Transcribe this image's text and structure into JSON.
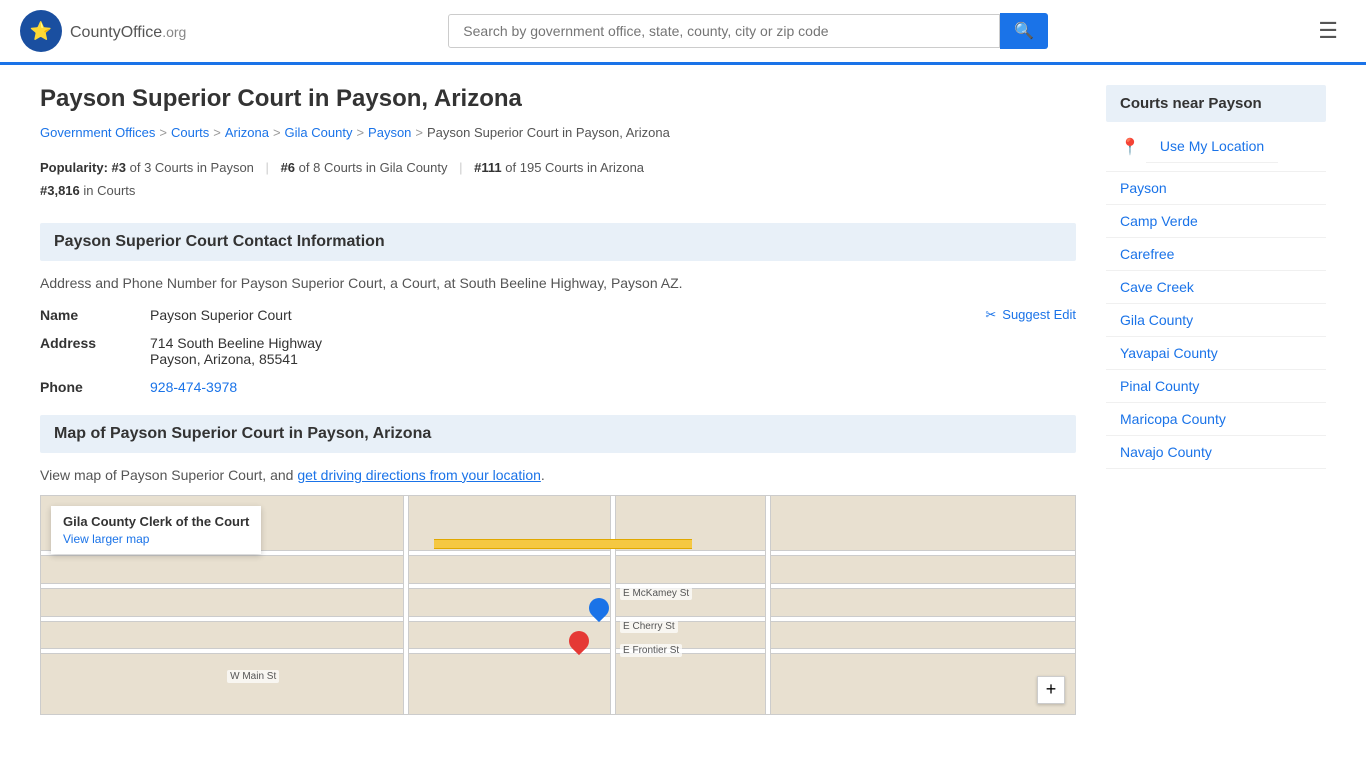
{
  "header": {
    "logo_text": "CountyOffice",
    "logo_suffix": ".org",
    "search_placeholder": "Search by government office, state, county, city or zip code",
    "search_icon": "🔍"
  },
  "page": {
    "title": "Payson Superior Court in Payson, Arizona",
    "breadcrumb": [
      {
        "label": "Government Offices",
        "href": "#"
      },
      {
        "label": "Courts",
        "href": "#"
      },
      {
        "label": "Arizona",
        "href": "#"
      },
      {
        "label": "Gila County",
        "href": "#"
      },
      {
        "label": "Payson",
        "href": "#"
      },
      {
        "label": "Payson Superior Court in Payson, Arizona",
        "href": "#"
      }
    ]
  },
  "popularity": {
    "label": "Popularity:",
    "rank1": "#3",
    "rank1_desc": "of 3 Courts in Payson",
    "rank2": "#6",
    "rank2_desc": "of 8 Courts in Gila County",
    "rank3": "#111",
    "rank3_desc": "of 195 Courts in Arizona",
    "rank4": "#3,816",
    "rank4_desc": "in Courts"
  },
  "contact": {
    "section_title": "Payson Superior Court Contact Information",
    "description": "Address and Phone Number for Payson Superior Court, a Court, at South Beeline Highway, Payson AZ.",
    "name_label": "Name",
    "name_value": "Payson Superior Court",
    "suggest_edit_label": "Suggest Edit",
    "address_label": "Address",
    "address_line1": "714 South Beeline Highway",
    "address_line2": "Payson, Arizona, 85541",
    "phone_label": "Phone",
    "phone_value": "928-474-3978"
  },
  "map": {
    "section_title": "Map of Payson Superior Court in Payson, Arizona",
    "description_prefix": "View map of Payson Superior Court, and ",
    "driving_directions_link": "get driving directions from your location",
    "description_suffix": ".",
    "overlay_title": "Gila County Clerk of the Court",
    "view_larger_map": "View larger map",
    "zoom_plus": "+"
  },
  "sidebar": {
    "title": "Courts near Payson",
    "use_location": "Use My Location",
    "items": [
      {
        "label": "Payson",
        "href": "#"
      },
      {
        "label": "Camp Verde",
        "href": "#"
      },
      {
        "label": "Carefree",
        "href": "#"
      },
      {
        "label": "Cave Creek",
        "href": "#"
      },
      {
        "label": "Gila County",
        "href": "#"
      },
      {
        "label": "Yavapai County",
        "href": "#"
      },
      {
        "label": "Pinal County",
        "href": "#"
      },
      {
        "label": "Maricopa County",
        "href": "#"
      },
      {
        "label": "Navajo County",
        "href": "#"
      }
    ]
  }
}
